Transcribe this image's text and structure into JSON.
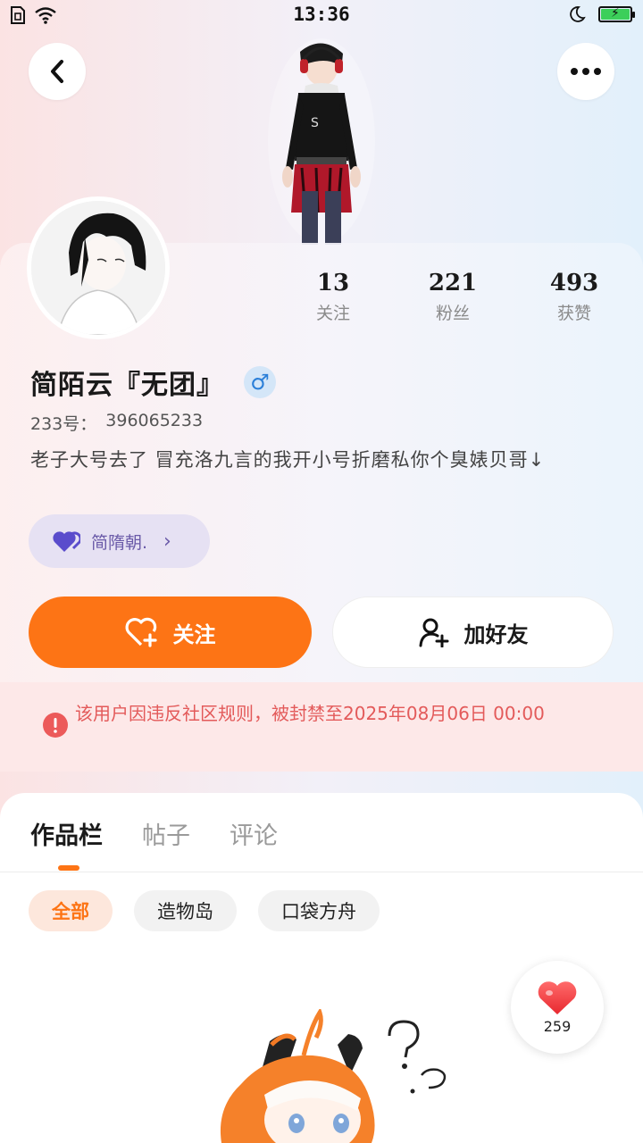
{
  "status_bar": {
    "time": "13:36"
  },
  "profile": {
    "stats": [
      {
        "count": "13",
        "label": "关注"
      },
      {
        "count": "221",
        "label": "粉丝"
      },
      {
        "count": "493",
        "label": "获赞"
      }
    ],
    "username": "简陌云『无团』",
    "gender_symbol": "♂",
    "uid_label": "233号：",
    "uid_value": "396065233",
    "bio": "老子大号去了  冒充洛九言的我开小号折磨私你个臭婊贝哥↓",
    "guild_name": "简隋朝."
  },
  "actions": {
    "follow_label": "关注",
    "add_friend_label": "加好友"
  },
  "ban_notice": "该用户因违反社区规则，被封禁至2025年08月06日 00:00",
  "tabs": [
    {
      "label": "作品栏",
      "active": true
    },
    {
      "label": "帖子",
      "active": false
    },
    {
      "label": "评论",
      "active": false
    }
  ],
  "filters": [
    {
      "label": "全部",
      "active": true
    },
    {
      "label": "造物岛",
      "active": false
    },
    {
      "label": "口袋方舟",
      "active": false
    }
  ],
  "like_count": "259",
  "colors": {
    "accent": "#fd7415",
    "ban_text": "#e35a5a",
    "ban_bg": "#fde8e8",
    "guild_bg": "#e6e1f3",
    "gender_badge": "#2b7fd8"
  }
}
